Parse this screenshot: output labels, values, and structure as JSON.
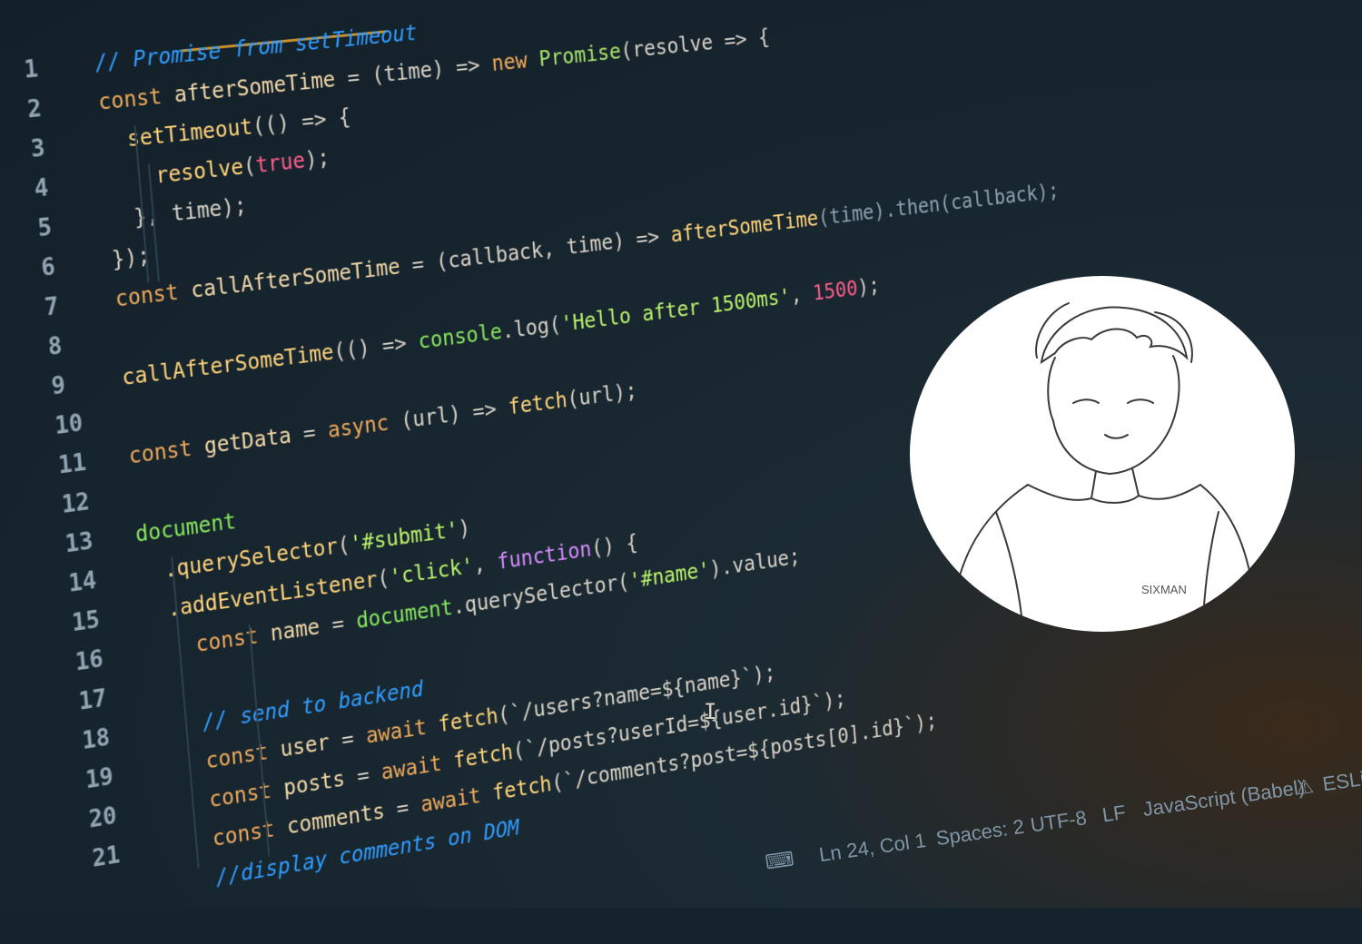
{
  "editor": {
    "line_numbers": [
      "1",
      "2",
      "3",
      "4",
      "5",
      "6",
      "7",
      "8",
      "9",
      "10",
      "11",
      "12",
      "13",
      "14",
      "15",
      "16",
      "17",
      "18",
      "19",
      "20",
      "21"
    ],
    "lines": [
      {
        "tokens": [
          {
            "t": "// Promise from setTimeout",
            "c": "cmt"
          }
        ]
      },
      {
        "tokens": [
          {
            "t": "const ",
            "c": "kw"
          },
          {
            "t": "afterSomeTime",
            "c": "id"
          },
          {
            "t": " = (time) => ",
            "c": "op"
          },
          {
            "t": "new ",
            "c": "kw"
          },
          {
            "t": "Promise",
            "c": "cls"
          },
          {
            "t": "(resolve => {",
            "c": "op"
          }
        ]
      },
      {
        "tokens": [
          {
            "t": "  setTimeout",
            "c": "fn"
          },
          {
            "t": "(() => {",
            "c": "op"
          }
        ]
      },
      {
        "tokens": [
          {
            "t": "    resolve",
            "c": "fn"
          },
          {
            "t": "(",
            "c": "op"
          },
          {
            "t": "true",
            "c": "bool"
          },
          {
            "t": ");",
            "c": "op"
          }
        ]
      },
      {
        "tokens": [
          {
            "t": "  }, time);",
            "c": "op"
          }
        ]
      },
      {
        "tokens": [
          {
            "t": "});",
            "c": "op"
          }
        ]
      },
      {
        "tokens": [
          {
            "t": "const ",
            "c": "kw"
          },
          {
            "t": "callAfterSomeTime",
            "c": "id"
          },
          {
            "t": " = (callback, time) => ",
            "c": "op"
          },
          {
            "t": "afterSomeTime",
            "c": "fn"
          },
          {
            "t": "(time).then(callback);",
            "c": "mute"
          }
        ]
      },
      {
        "tokens": []
      },
      {
        "tokens": [
          {
            "t": "callAfterSomeTime",
            "c": "fn"
          },
          {
            "t": "(() => ",
            "c": "op"
          },
          {
            "t": "console",
            "c": "green"
          },
          {
            "t": ".log(",
            "c": "op"
          },
          {
            "t": "'Hello after 1500ms'",
            "c": "str"
          },
          {
            "t": ", ",
            "c": "op"
          },
          {
            "t": "1500",
            "c": "bool"
          },
          {
            "t": ");",
            "c": "op"
          }
        ]
      },
      {
        "tokens": []
      },
      {
        "tokens": [
          {
            "t": "const ",
            "c": "kw"
          },
          {
            "t": "getData",
            "c": "id"
          },
          {
            "t": " = ",
            "c": "op"
          },
          {
            "t": "async ",
            "c": "kw"
          },
          {
            "t": "(url) => ",
            "c": "op"
          },
          {
            "t": "fetch",
            "c": "fn"
          },
          {
            "t": "(url);",
            "c": "op"
          }
        ]
      },
      {
        "tokens": []
      },
      {
        "tokens": [
          {
            "t": "document",
            "c": "green"
          }
        ]
      },
      {
        "tokens": [
          {
            "t": "  .querySelector",
            "c": "fn"
          },
          {
            "t": "(",
            "c": "op"
          },
          {
            "t": "'#submit'",
            "c": "str"
          },
          {
            "t": ")",
            "c": "op"
          }
        ]
      },
      {
        "tokens": [
          {
            "t": "  .addEventListener",
            "c": "fn"
          },
          {
            "t": "(",
            "c": "op"
          },
          {
            "t": "'click'",
            "c": "str"
          },
          {
            "t": ", ",
            "c": "op"
          },
          {
            "t": "function",
            "c": "purple"
          },
          {
            "t": "() {",
            "c": "op"
          }
        ]
      },
      {
        "tokens": [
          {
            "t": "    const ",
            "c": "kw"
          },
          {
            "t": "name",
            "c": "id"
          },
          {
            "t": " = ",
            "c": "op"
          },
          {
            "t": "document",
            "c": "green"
          },
          {
            "t": ".querySelector(",
            "c": "op"
          },
          {
            "t": "'#name'",
            "c": "str"
          },
          {
            "t": ").value;",
            "c": "op"
          }
        ]
      },
      {
        "tokens": []
      },
      {
        "tokens": [
          {
            "t": "    // send to backend",
            "c": "cmt"
          }
        ]
      },
      {
        "tokens": [
          {
            "t": "    const ",
            "c": "kw"
          },
          {
            "t": "user",
            "c": "id"
          },
          {
            "t": " = ",
            "c": "op"
          },
          {
            "t": "await ",
            "c": "kw"
          },
          {
            "t": "fetch",
            "c": "fn"
          },
          {
            "t": "(`/users?name=${name}`);",
            "c": "op"
          }
        ]
      },
      {
        "tokens": [
          {
            "t": "    const ",
            "c": "kw"
          },
          {
            "t": "posts",
            "c": "id"
          },
          {
            "t": " = ",
            "c": "op"
          },
          {
            "t": "await ",
            "c": "kw"
          },
          {
            "t": "fetch",
            "c": "fn"
          },
          {
            "t": "(`/posts?userId=${user.id}`);",
            "c": "op"
          }
        ]
      },
      {
        "tokens": [
          {
            "t": "    const ",
            "c": "kw"
          },
          {
            "t": "comments",
            "c": "id"
          },
          {
            "t": " = ",
            "c": "op"
          },
          {
            "t": "await ",
            "c": "kw"
          },
          {
            "t": "fetch",
            "c": "fn"
          },
          {
            "t": "(`/comments?post=${posts[0].id}`);",
            "c": "op"
          }
        ]
      },
      {
        "tokens": [
          {
            "t": "    //display comments on DOM",
            "c": "cmt"
          }
        ]
      }
    ]
  },
  "status_bar": {
    "position": "Ln 24, Col 1",
    "spaces": "Spaces: 2",
    "encoding": "UTF-8",
    "eol": "LF",
    "language": "JavaScript (Babel)",
    "lint": "ESLint"
  },
  "avatar": {
    "shirt_text": "SIXMAN"
  },
  "colors": {
    "background": "#15232d",
    "keyword": "#f0a95a",
    "string": "#b9f36a",
    "comment": "#2f9cff",
    "boolean": "#ff5c8a",
    "accent": "#c9902d"
  },
  "icons": {
    "terminal": "terminal-icon",
    "warning": "warning-icon",
    "notification": "bell-icon"
  }
}
